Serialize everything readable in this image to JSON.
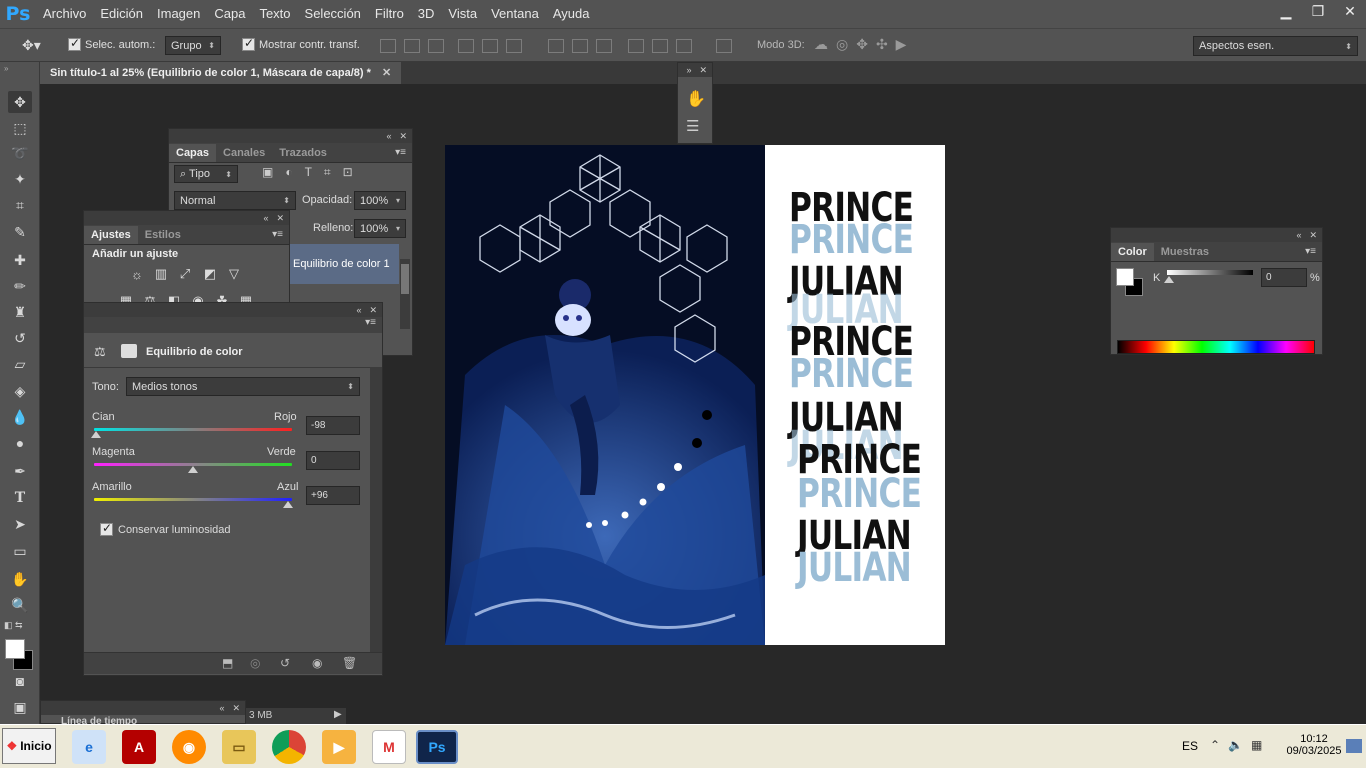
{
  "menubar": {
    "logo": "Ps",
    "items": [
      "Archivo",
      "Edición",
      "Imagen",
      "Capa",
      "Texto",
      "Selección",
      "Filtro",
      "3D",
      "Vista",
      "Ventana",
      "Ayuda"
    ]
  },
  "options": {
    "auto_select": "Selec. autom.:",
    "group": "Grupo",
    "show_transform": "Mostrar contr. transf.",
    "mode3d": "Modo 3D:",
    "workspace": "Aspectos esen."
  },
  "document": {
    "tab": "Sin título-1 al 25% (Equilibrio de color 1, Máscara de capa/8) *"
  },
  "layers": {
    "tabs": [
      "Capas",
      "Canales",
      "Trazados"
    ],
    "filter": "Tipo",
    "blend": "Normal",
    "opacity_label": "Opacidad:",
    "opacity": "100%",
    "fill_label": "Relleno:",
    "fill": "100%",
    "layer_name": "Equilibrio de color 1"
  },
  "adjust": {
    "tabs": [
      "Ajustes",
      "Estilos"
    ],
    "heading": "Añadir un ajuste"
  },
  "props": {
    "title": "Equilibrio de color",
    "tone_label": "Tono:",
    "tone": "Medios tonos",
    "cyan": "Cian",
    "red": "Rojo",
    "cyan_red": "-98",
    "cyan_red_frac": 0.01,
    "magenta": "Magenta",
    "green": "Verde",
    "magenta_green": "0",
    "magenta_green_frac": 0.5,
    "yellow": "Amarillo",
    "blue": "Azul",
    "yellow_blue": "+96",
    "yellow_blue_frac": 0.98,
    "preserve": "Conservar luminosidad"
  },
  "color": {
    "tabs": [
      "Color",
      "Muestras"
    ],
    "k_label": "K",
    "k_value": "0",
    "pct": "%"
  },
  "timeline": {
    "label": "Línea de tiempo",
    "size": "3 MB"
  },
  "art": {
    "lines": [
      "PRINCE",
      "PRINCE",
      "JULIAN",
      "JULIAN",
      "PRINCE",
      "PRINCE",
      "JULIAN",
      "JULIAN",
      "PRINCE",
      "PRINCE",
      "JULIAN",
      "JULIAN"
    ]
  },
  "taskbar": {
    "start": "Inicio",
    "lang": "ES",
    "time": "10:12",
    "date": "09/03/2025"
  },
  "colors": {
    "ps_blue": "#31a8ff",
    "art_light": "#9bbdd6",
    "art_dark": "#111111",
    "art_bg": "#0a1a44"
  }
}
